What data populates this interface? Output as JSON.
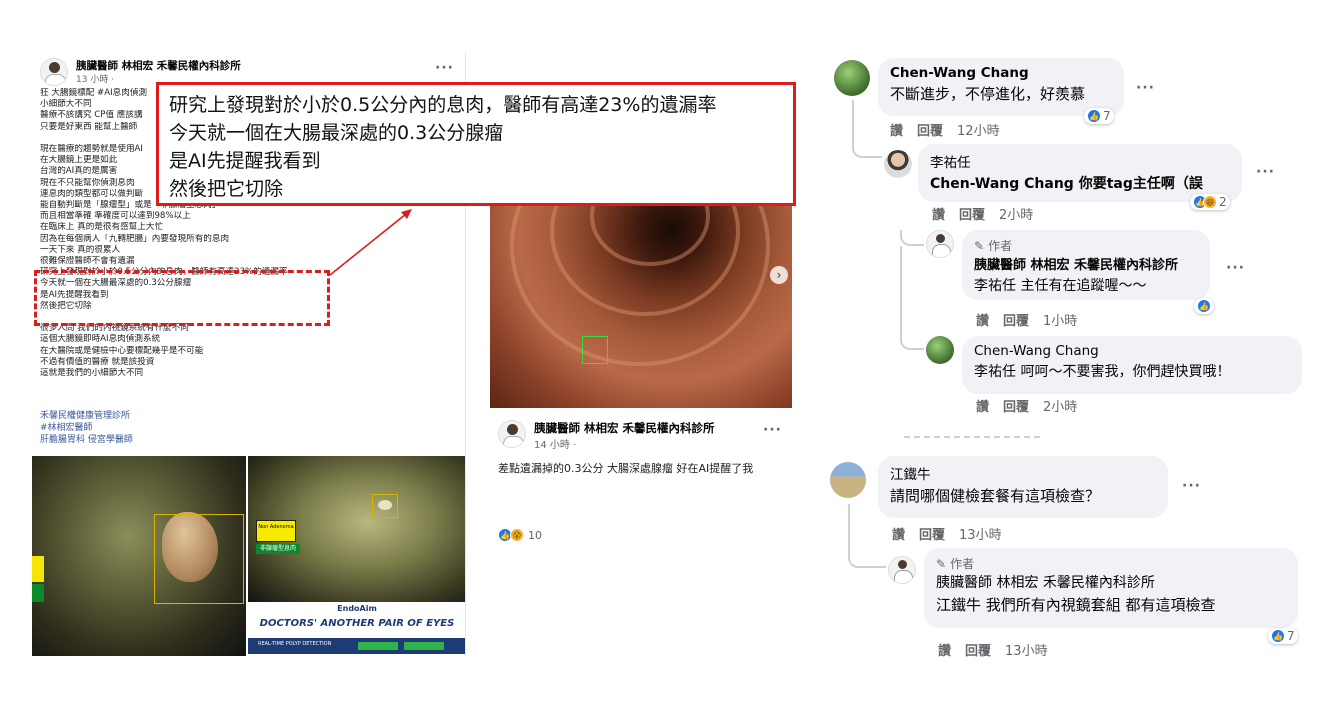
{
  "left_post": {
    "author": "胰臟醫師 林相宏 禾馨民權內科診所",
    "time": "13 小時 ·",
    "more": "···",
    "body_lines": [
      "狂 大腸鏡標配 #AI息肉偵測",
      "小細節大不同",
      "醫療不該講究 CP值 應該講",
      "只要是好東西 能幫上醫師",
      "",
      "現在醫療的趨勢就是使用AI",
      "在大腸鏡上更是如此",
      "台灣的AI真的是厲害",
      "現在不只能幫你偵測息肉",
      "連息肉的類型都可以做判斷",
      "能自動判斷是「腺瘤型」或是「非腺瘤型息肉」",
      "而且相當準確 準確度可以達到98%以上",
      "在臨床上 真的是很有感幫上大忙",
      "因為在每個病人「九轉肥腸」內要發現所有的息肉",
      "一天下來 真的很累人",
      "很難保證醫師不會有遺漏",
      "研究上發現對於小於0.5公分內的息肉，醫師有高達23%的遺漏率",
      "今天就一個在大腸最深處的0.3公分腺瘤",
      "是AI先提醒我看到",
      "然後把它切除",
      "",
      "很多人問 我們的內視鏡系統有什麼不同",
      "這個大腸鏡即時AI息肉偵測系統",
      "在大醫院或是健檢中心要標配幾乎是不可能",
      "不過有價值的醫療 就是該投資",
      "這就是我們的小細節大不同"
    ],
    "links": [
      "禾馨民權健康管理診所",
      "#林相宏醫師",
      "肝膽腸胃科   侵宮學醫師"
    ]
  },
  "endo_panel": {
    "non_adenoma_label": "Non Adenoma",
    "green_tag": "非腺瘤型息肉",
    "brand": "EndoAim",
    "slogan": "DOCTORS' ANOTHER PAIR OF EYES",
    "bar_text": "REAL-TIME POLYP DETECTION"
  },
  "callout": {
    "lines": [
      "研究上發現對於小於0.5公分內的息肉，醫師有高達23%的遺漏率",
      "今天就一個在大腸最深處的0.3公分腺瘤",
      "是AI先提醒我看到",
      "然後把它切除"
    ]
  },
  "mid_post": {
    "author": "胰臟醫師 林相宏 禾馨民權內科診所",
    "time": "14 小時 ·",
    "more": "···",
    "text": "差點遺漏掉的0.3公分 大腸深處腺瘤 好在AI提醒了我",
    "reaction_count": "10",
    "zoom_in": "⊕",
    "zoom_out": "⊖",
    "expand": "⤢",
    "next": "›"
  },
  "comments": [
    {
      "name": "Chen-Wang Chang",
      "text": "不斷進步，不停進化，好羨慕",
      "like": "讚",
      "reply": "回覆",
      "time": "12小時",
      "reactions": "7"
    },
    {
      "name": "李祐任",
      "text": "Chen-Wang Chang 你要tag主任啊（誤",
      "like": "讚",
      "reply": "回覆",
      "time": "2小時",
      "reactions": "2"
    },
    {
      "author_tag": "作者",
      "name": "胰臟醫師 林相宏 禾馨民權內科診所",
      "text": "李祐任 主任有在追蹤喔～～",
      "like": "讚",
      "reply": "回覆",
      "time": "1小時"
    },
    {
      "name": "Chen-Wang Chang",
      "text": "李祐任 呵呵～不要害我，你們趕快買哦！",
      "like": "讚",
      "reply": "回覆",
      "time": "2小時"
    },
    {
      "name": "江鐵牛",
      "text": "請問哪個健檢套餐有這項檢查？",
      "like": "讚",
      "reply": "回覆",
      "time": "13小時"
    },
    {
      "author_tag": "作者",
      "name": "胰臟醫師 林相宏 禾馨民權內科診所",
      "text": "江鐵牛 我們所有內視鏡套組 都有這項檢查",
      "like": "讚",
      "reply": "回覆",
      "time": "13小時",
      "reactions": "7"
    }
  ],
  "colors": {
    "highlight_red": "#e01b1b",
    "fb_blue": "#1877f2",
    "bubble_grey": "#f0f2f5"
  }
}
